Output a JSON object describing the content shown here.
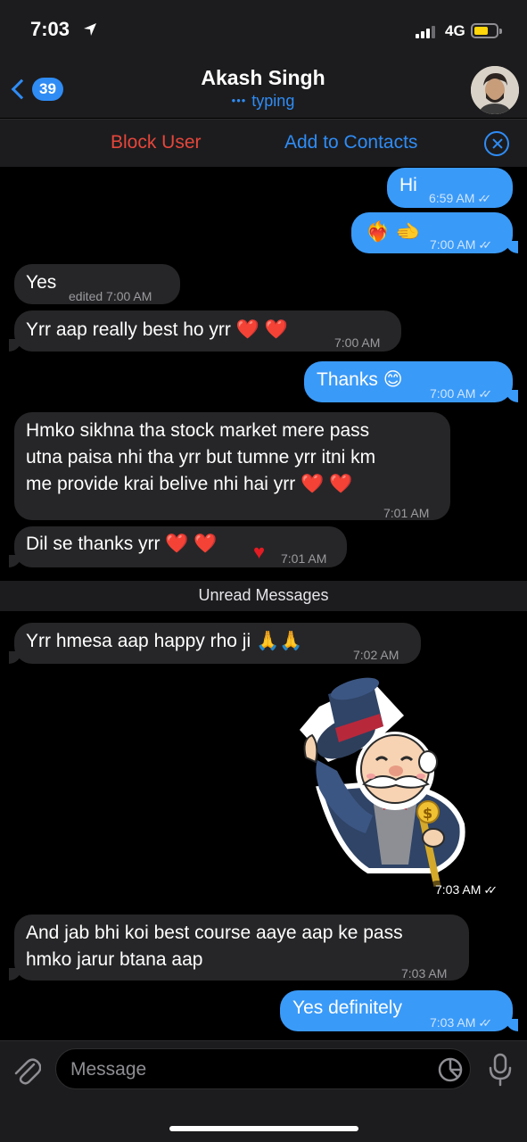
{
  "status_bar": {
    "time": "7:03",
    "network": "4G"
  },
  "header": {
    "back_badge": "39",
    "contact_name": "Akash Singh",
    "contact_status": "typing"
  },
  "action_bar": {
    "block_label": "Block User",
    "add_label": "Add to Contacts"
  },
  "messages": [
    {
      "dir": "out",
      "text": "Hi",
      "time": "6:59 AM"
    },
    {
      "dir": "out",
      "text": "❤️‍🔥 🫲",
      "time": "7:00 AM"
    },
    {
      "dir": "in",
      "text": "Yes",
      "edited": "edited",
      "time": "7:00 AM"
    },
    {
      "dir": "in",
      "text": "Yrr aap really best ho yrr ❤️ ❤️",
      "time": "7:00 AM"
    },
    {
      "dir": "out",
      "text": "Thanks 😊",
      "time": "7:00 AM"
    },
    {
      "dir": "in",
      "lines": [
        "Hmko sikhna tha stock market mere pass",
        "utna paisa nhi tha yrr but tumne yrr itni km",
        "me provide krai belive nhi hai yrr ❤️ ❤️"
      ],
      "time": "7:01 AM"
    },
    {
      "dir": "in",
      "text": "Dil se thanks yrr ❤️ ❤️",
      "reaction": "♥",
      "time": "7:01 AM"
    },
    {
      "dir": "in",
      "text": "Yrr hmesa aap happy rho ji 🙏🙏",
      "time": "7:02 AM"
    },
    {
      "dir": "out",
      "type": "sticker",
      "time": "7:03 AM"
    },
    {
      "dir": "in",
      "lines": [
        "And jab bhi koi best course aaye aap ke pass",
        "hmko jarur btana aap"
      ],
      "time": "7:03 AM"
    },
    {
      "dir": "out",
      "text": "Yes definitely",
      "time": "7:03 AM"
    }
  ],
  "unread_divider": "Unread Messages",
  "composer": {
    "placeholder": "Message"
  },
  "colors": {
    "accent": "#2f8cf5",
    "outgoing": "#3a9af8",
    "incoming": "#262628",
    "danger": "#e5463b"
  }
}
